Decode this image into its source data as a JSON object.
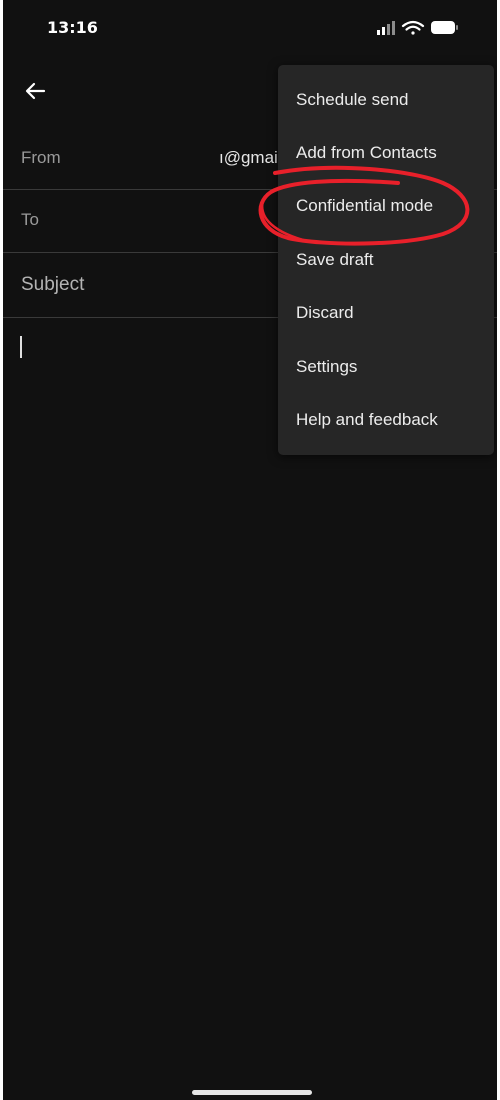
{
  "status_bar": {
    "time": "13:16"
  },
  "compose": {
    "from_label": "From",
    "from_value": "ı@gmai",
    "to_label": "To",
    "subject_label": "Subject"
  },
  "menu": {
    "items": [
      {
        "label": "Schedule send"
      },
      {
        "label": "Add from Contacts"
      },
      {
        "label": "Confidential mode"
      },
      {
        "label": "Save draft"
      },
      {
        "label": "Discard"
      },
      {
        "label": "Settings"
      },
      {
        "label": "Help and feedback"
      }
    ]
  },
  "annotation": {
    "highlighted_item": "Confidential mode",
    "color": "#e8202a"
  },
  "colors": {
    "background": "#111111",
    "menu_background": "#262626",
    "text_primary": "#ececec",
    "text_secondary": "#9a9a9a"
  }
}
